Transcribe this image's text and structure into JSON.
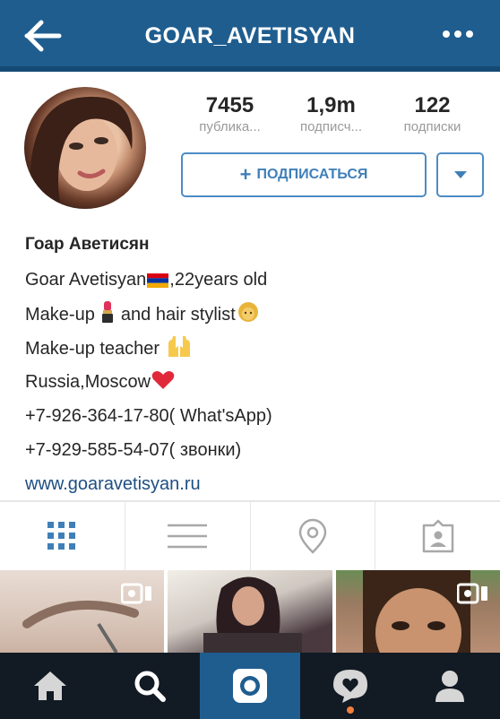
{
  "header": {
    "title": "GOAR_AVETISYAN",
    "back_icon": "arrow-left-icon",
    "more_icon": "more-dots-icon"
  },
  "profile": {
    "stats": [
      {
        "value": "7455",
        "label": "публика..."
      },
      {
        "value": "1,9m",
        "label": "подписч..."
      },
      {
        "value": "122",
        "label": "подписки"
      }
    ],
    "follow_label": "ПОДПИСАТЬСЯ",
    "follow_plus": "+",
    "name": "Гоар Аветисян",
    "bio": {
      "line1": "Goar Avetisyan",
      "line1_suffix": ",22years old",
      "line2_a": "Make-up ",
      "line2_b": " and hair stylist",
      "line3": "Make-up teacher ",
      "line4": "Russia,Moscow",
      "line5": "+7-926-364-17-80( What'sApp)",
      "line6": "+7-929-585-54-07( звонки)",
      "website": "www.goaravetisyan.ru"
    }
  },
  "tabs": [
    "grid-icon",
    "list-icon",
    "location-pin-icon",
    "tagged-photos-icon"
  ],
  "bottom_nav": [
    "home-icon",
    "search-icon",
    "camera-icon",
    "activity-heart-icon",
    "profile-icon"
  ],
  "colors": {
    "header": "#1f5d8f",
    "accent": "#3f7fb8",
    "link": "#1d4f82",
    "bottom_bar": "#121a24",
    "notification": "#f0803c"
  }
}
